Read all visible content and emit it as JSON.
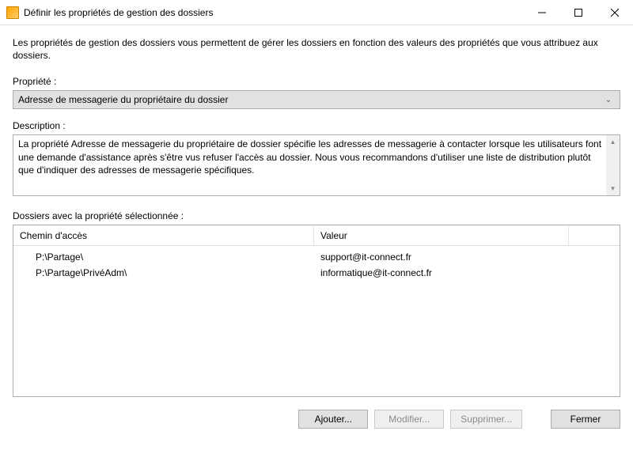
{
  "window": {
    "title": "Définir les propriétés de gestion des dossiers"
  },
  "intro_text": "Les propriétés de gestion des dossiers vous permettent de gérer les dossiers en fonction des valeurs des propriétés que vous attribuez aux dossiers.",
  "property": {
    "label": "Propriété :",
    "selected": "Adresse de messagerie du propriétaire du dossier"
  },
  "description": {
    "label": "Description :",
    "text": "La propriété Adresse de messagerie du propriétaire de dossier spécifie les adresses de messagerie à contacter lorsque les utilisateurs font une demande d'assistance après s'être vus refuser l'accès au dossier. Nous vous recommandons d'utiliser une liste de distribution plutôt que d'indiquer des adresses de messagerie spécifiques."
  },
  "folders": {
    "label": "Dossiers avec la propriété sélectionnée :",
    "columns": {
      "path": "Chemin d'accès",
      "value": "Valeur"
    },
    "rows": [
      {
        "path": "P:\\Partage\\",
        "value": "support@it-connect.fr"
      },
      {
        "path": "P:\\Partage\\PrivéAdm\\",
        "value": "informatique@it-connect.fr"
      }
    ]
  },
  "buttons": {
    "add": "Ajouter...",
    "edit": "Modifier...",
    "delete": "Supprimer...",
    "close": "Fermer"
  }
}
